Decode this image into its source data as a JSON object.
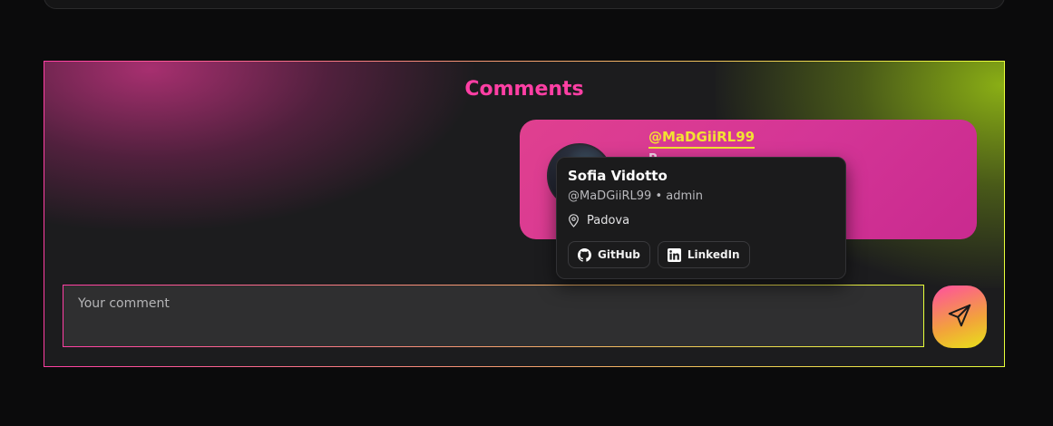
{
  "section": {
    "title": "Comments"
  },
  "comment": {
    "author": "@MaDGiiRL99",
    "text": "P"
  },
  "popover": {
    "name": "Sofia Vidotto",
    "handle_role": "@MaDGiiRL99 • admin",
    "location": "Padova",
    "links": [
      {
        "label": "GitHub",
        "icon": "github-icon"
      },
      {
        "label": "LinkedIn",
        "icon": "linkedin-icon"
      }
    ]
  },
  "composer": {
    "placeholder": "Your comment",
    "send_icon": "send-icon"
  },
  "colors": {
    "accent_pink": "#ff3fa4",
    "accent_lime": "#e8ff3a",
    "author_yellow": "#f3e232"
  }
}
